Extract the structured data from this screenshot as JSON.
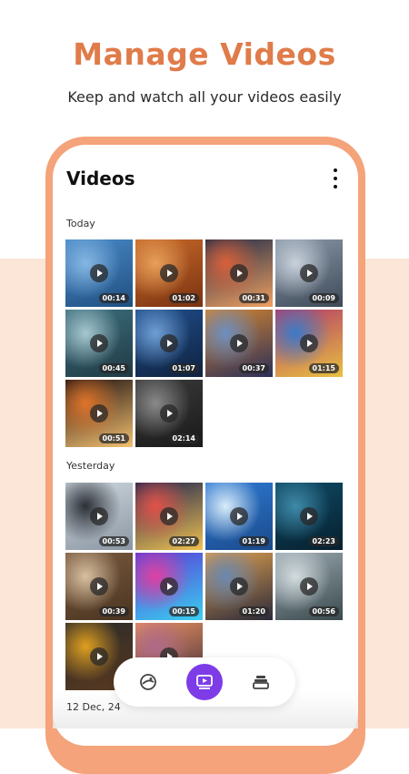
{
  "promo": {
    "headline": "Manage Videos",
    "subline": "Keep and watch all your videos easily"
  },
  "app": {
    "title": "Videos",
    "menu_icon": "more-vertical-icon"
  },
  "sections": [
    {
      "label": "Today",
      "videos": [
        {
          "duration": "00:14",
          "colors": [
            "#4a8ac9",
            "#86b7e3",
            "#1f4f80"
          ]
        },
        {
          "duration": "01:02",
          "colors": [
            "#c7692a",
            "#e8a05a",
            "#7a3210"
          ]
        },
        {
          "duration": "00:31",
          "colors": [
            "#1d2b4a",
            "#d8613a",
            "#f0a060"
          ]
        },
        {
          "duration": "00:09",
          "colors": [
            "#8a98a8",
            "#c9d2dc",
            "#3e4a58"
          ]
        },
        {
          "duration": "00:45",
          "colors": [
            "#3d6f7e",
            "#a7c8cf",
            "#1f3a44"
          ]
        },
        {
          "duration": "01:07",
          "colors": [
            "#1f4e8c",
            "#6f9fd6",
            "#0f223f"
          ]
        },
        {
          "duration": "00:37",
          "colors": [
            "#d6862e",
            "#6d8fc0",
            "#2a2f5a"
          ]
        },
        {
          "duration": "01:15",
          "colors": [
            "#b33a6a",
            "#3c7ac8",
            "#e8c040"
          ]
        },
        {
          "duration": "00:51",
          "colors": [
            "#1b1010",
            "#e0742a",
            "#f4c070"
          ]
        },
        {
          "duration": "02:14",
          "colors": [
            "#3a3a3a",
            "#8a8a8a",
            "#1a1a1a"
          ]
        }
      ]
    },
    {
      "label": "Yesterday",
      "videos": [
        {
          "duration": "00:53",
          "colors": [
            "#cfd8e0",
            "#2b2f36",
            "#8a96a2"
          ]
        },
        {
          "duration": "02:27",
          "colors": [
            "#1b2450",
            "#e2524a",
            "#f0c050"
          ]
        },
        {
          "duration": "01:19",
          "colors": [
            "#2e7ad4",
            "#d9ecfa",
            "#1a4a8a"
          ]
        },
        {
          "duration": "02:23",
          "colors": [
            "#0f4a66",
            "#3f8aa8",
            "#06202e"
          ]
        },
        {
          "duration": "00:39",
          "colors": [
            "#7a5a40",
            "#d8c0a0",
            "#4a3420"
          ]
        },
        {
          "duration": "00:15",
          "colors": [
            "#5a3ad6",
            "#e040a0",
            "#3ad0f0"
          ]
        },
        {
          "duration": "01:20",
          "colors": [
            "#e0a050",
            "#6a88b0",
            "#2a2a3a"
          ]
        },
        {
          "duration": "00:56",
          "colors": [
            "#9aa8b0",
            "#d4dcdf",
            "#3a4a4e"
          ]
        },
        {
          "duration": "",
          "colors": [
            "#2a2a2a",
            "#e0a020",
            "#5a3a20"
          ]
        },
        {
          "duration": "",
          "colors": [
            "#e89060",
            "#b06a8a",
            "#3a2a3a"
          ]
        }
      ]
    }
  ],
  "next_section_label": "12 Dec, 24",
  "bottom_nav": [
    {
      "icon": "photo-lens-icon",
      "active": false
    },
    {
      "icon": "video-play-icon",
      "active": true
    },
    {
      "icon": "album-stack-icon",
      "active": false
    }
  ],
  "colors": {
    "accent_orange": "#e07b4a",
    "phone_frame": "#f4a37a",
    "background_band": "#fce6d8",
    "nav_active": "#7d3ce8"
  }
}
